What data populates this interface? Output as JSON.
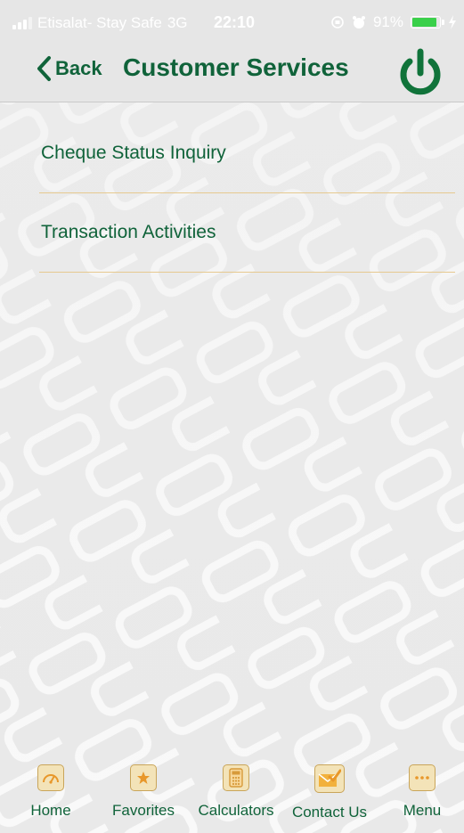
{
  "status_bar": {
    "carrier": "Etisalat- Stay Safe",
    "network": "3G",
    "time": "22:10",
    "battery": "91%",
    "battery_level": 0.91
  },
  "nav": {
    "back_label": "Back",
    "title": "Customer Services"
  },
  "menu": {
    "items": [
      {
        "label": "Cheque Status Inquiry"
      },
      {
        "label": "Transaction Activities"
      }
    ]
  },
  "tabs": [
    {
      "label": "Home",
      "icon": "speedometer-icon"
    },
    {
      "label": "Favorites",
      "icon": "star-icon"
    },
    {
      "label": "Calculators",
      "icon": "calculator-icon"
    },
    {
      "label": "Contact Us",
      "icon": "envelope-check-icon"
    },
    {
      "label": "Menu",
      "icon": "more-dots-icon"
    }
  ],
  "colors": {
    "brand_green": "#10633a",
    "accent_orange": "#e8972a",
    "background": "#ededed",
    "divider": "#e6c98f"
  }
}
